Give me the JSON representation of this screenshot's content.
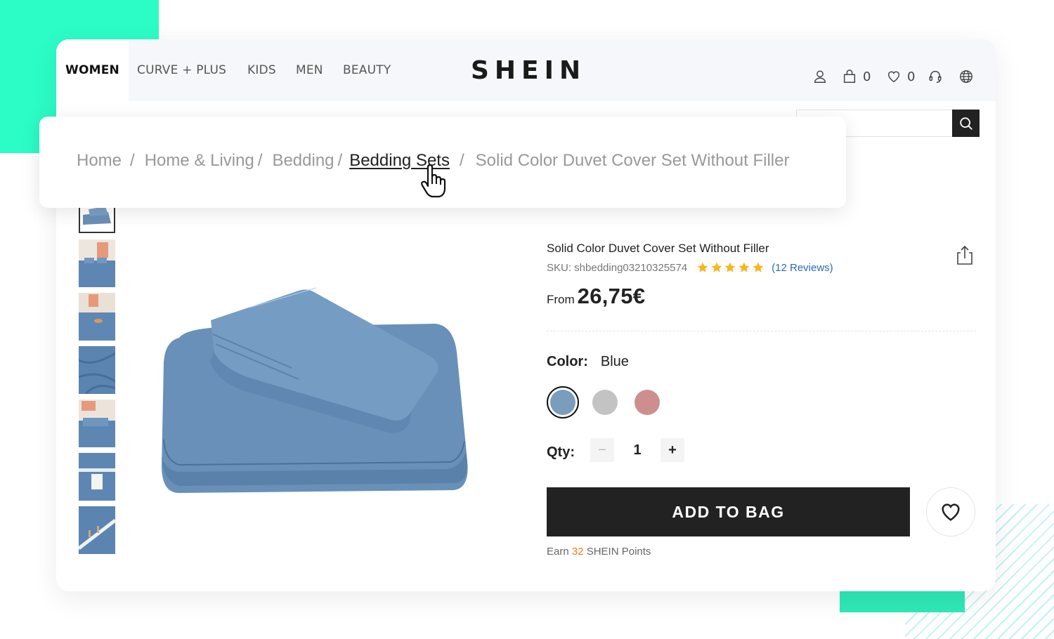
{
  "nav": {
    "tabs": [
      {
        "label": "WOMEN",
        "active": true
      },
      {
        "label": "CURVE + PLUS",
        "active": false
      },
      {
        "label": "KIDS",
        "active": false
      },
      {
        "label": "MEN",
        "active": false
      },
      {
        "label": "BEAUTY",
        "active": false
      }
    ],
    "logo": "SHEIN",
    "icons": {
      "account": "user-icon",
      "bag": "bag-icon",
      "wishlist": "heart-icon",
      "support": "headset-icon",
      "language": "globe-icon"
    },
    "bag_count": "0",
    "wishlist_count": "0",
    "search": {
      "value": "",
      "placeholder": "",
      "icon": "search-icon"
    }
  },
  "breadcrumb": {
    "items": [
      {
        "label": "Home",
        "state": "normal"
      },
      {
        "label": "Home & Living",
        "state": "normal"
      },
      {
        "label": "Bedding",
        "state": "normal"
      },
      {
        "label": "Bedding Sets",
        "state": "hover"
      },
      {
        "label": "Solid Color Duvet Cover Set Without Filler",
        "state": "current"
      }
    ],
    "separator": "/"
  },
  "gallery": {
    "thumbnails": [
      {
        "alt": "folded blue duvet set",
        "selected": true
      },
      {
        "alt": "blue bedding on bed with pink art",
        "selected": false
      },
      {
        "alt": "blue bedding with tray",
        "selected": false
      },
      {
        "alt": "blue fabric close-up",
        "selected": false
      },
      {
        "alt": "blue pillows on bed",
        "selected": false
      },
      {
        "alt": "care label detail",
        "selected": false
      },
      {
        "alt": "zipper detail",
        "selected": false
      }
    ],
    "main_image_alt": "Folded blue duvet cover set with pillowcases"
  },
  "product": {
    "title": "Solid Color Duvet Cover Set Without Filler",
    "sku": "SKU: shbedding03210325574",
    "rating": 5,
    "rating_max": 5,
    "reviews": "(12 Reviews)",
    "price_prefix": "From",
    "price": "26,75€",
    "color_label": "Color:",
    "color_value": "Blue",
    "colors": [
      {
        "name": "Blue",
        "hex": "#7b9dbd",
        "selected": true
      },
      {
        "name": "Grey",
        "hex": "#c4c3c4",
        "selected": false
      },
      {
        "name": "Pink",
        "hex": "#cc8f8e",
        "selected": false
      }
    ],
    "qty_label": "Qty:",
    "qty_minus": "−",
    "qty_value": "1",
    "qty_plus": "+",
    "add_to_bag": "ADD TO BAG",
    "points_prefix": "Earn",
    "points": "32",
    "points_suffix": "SHEIN Points"
  },
  "colors": {
    "accent_green": "#2cfcc6",
    "button_dark": "#222222",
    "link_blue": "#2a6bb5",
    "star_yellow": "#f8b51c",
    "points_orange": "#f07b1d"
  }
}
